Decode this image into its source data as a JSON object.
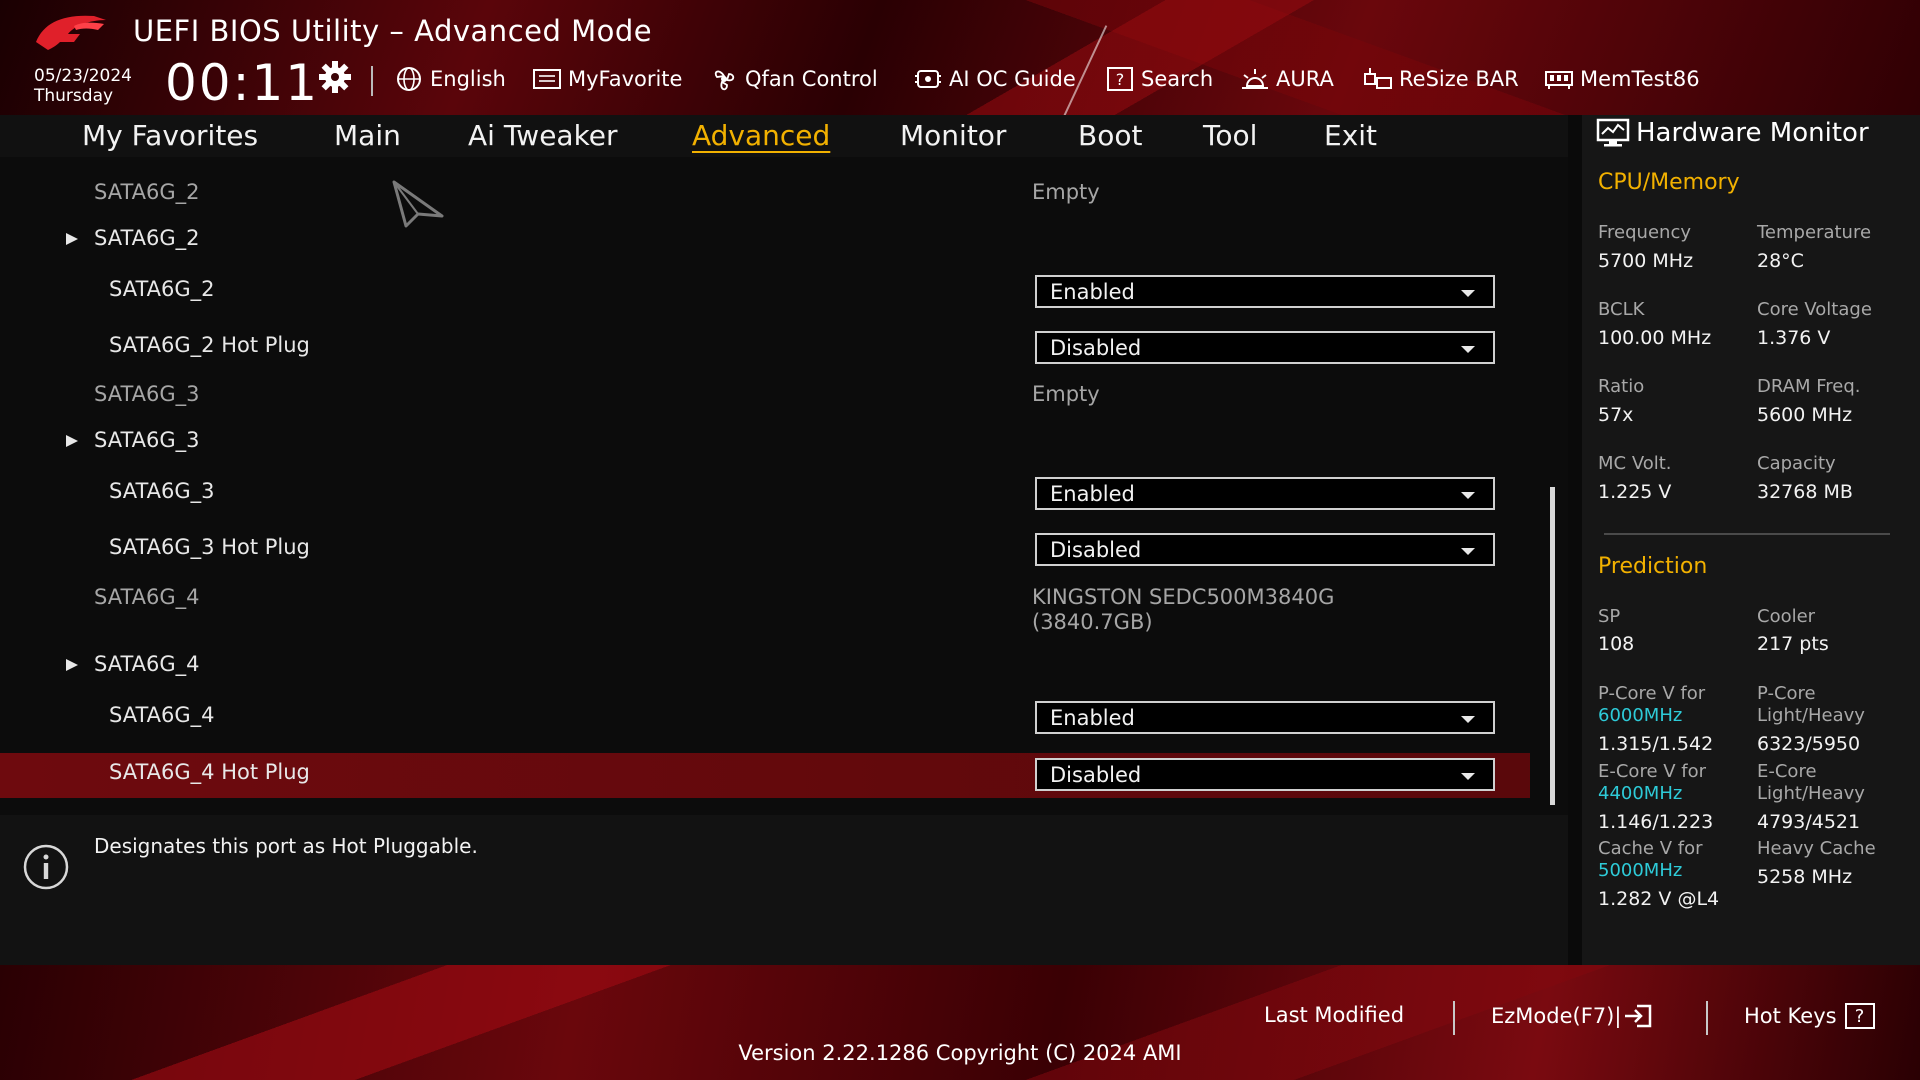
{
  "header": {
    "title": "UEFI BIOS Utility – Advanced Mode",
    "date": "05/23/2024",
    "day": "Thursday",
    "time": "00:11",
    "tools": [
      {
        "label": "English",
        "icon": "globe-icon"
      },
      {
        "label": "MyFavorite",
        "icon": "favorite-icon"
      },
      {
        "label": "Qfan Control",
        "icon": "fan-icon"
      },
      {
        "label": "AI OC Guide",
        "icon": "ai-oc-icon"
      },
      {
        "label": "Search",
        "icon": "search-icon"
      },
      {
        "label": "AURA",
        "icon": "aura-icon"
      },
      {
        "label": "ReSize BAR",
        "icon": "resize-bar-icon"
      },
      {
        "label": "MemTest86",
        "icon": "memtest-icon"
      }
    ]
  },
  "menu": {
    "tabs": [
      "My Favorites",
      "Main",
      "Ai Tweaker",
      "Advanced",
      "Monitor",
      "Boot",
      "Tool",
      "Exit"
    ],
    "active": "Advanced"
  },
  "rows": {
    "sata2_info": {
      "label": "SATA6G_2",
      "value": "Empty"
    },
    "sata2_group": {
      "label": "SATA6G_2"
    },
    "sata2_port": {
      "label": "SATA6G_2",
      "value": "Enabled"
    },
    "sata2_hotplug": {
      "label": "SATA6G_2 Hot Plug",
      "value": "Disabled"
    },
    "sata3_info": {
      "label": "SATA6G_3",
      "value": "Empty"
    },
    "sata3_group": {
      "label": "SATA6G_3"
    },
    "sata3_port": {
      "label": "SATA6G_3",
      "value": "Enabled"
    },
    "sata3_hotplug": {
      "label": "SATA6G_3 Hot Plug",
      "value": "Disabled"
    },
    "sata4_info": {
      "label": "SATA6G_4",
      "value_line1": "KINGSTON SEDC500M3840G",
      "value_line2": "(3840.7GB)"
    },
    "sata4_group": {
      "label": "SATA6G_4"
    },
    "sata4_port": {
      "label": "SATA6G_4",
      "value": "Enabled"
    },
    "sata4_hotplug": {
      "label": "SATA6G_4 Hot Plug",
      "value": "Disabled"
    }
  },
  "help": {
    "text": "Designates this port as Hot Pluggable."
  },
  "hw_monitor": {
    "title": "Hardware Monitor",
    "cpu_memory": {
      "section": "CPU/Memory",
      "frequency": {
        "label": "Frequency",
        "value": "5700 MHz"
      },
      "temperature": {
        "label": "Temperature",
        "value": "28°C"
      },
      "bclk": {
        "label": "BCLK",
        "value": "100.00 MHz"
      },
      "core_voltage": {
        "label": "Core Voltage",
        "value": "1.376 V"
      },
      "ratio": {
        "label": "Ratio",
        "value": "57x"
      },
      "dram_freq": {
        "label": "DRAM Freq.",
        "value": "5600 MHz"
      },
      "mc_volt": {
        "label": "MC Volt.",
        "value": "1.225 V"
      },
      "capacity": {
        "label": "Capacity",
        "value": "32768 MB"
      }
    },
    "prediction": {
      "section": "Prediction",
      "sp": {
        "label": "SP",
        "value": "108"
      },
      "cooler": {
        "label": "Cooler",
        "value": "217 pts"
      },
      "pcore_v": {
        "label": "P-Core V for",
        "freq": "6000MHz",
        "value": "1.315/1.542"
      },
      "pcore_lh": {
        "label_line1": "P-Core",
        "label_line2": "Light/Heavy",
        "value": "6323/5950"
      },
      "ecore_v": {
        "label": "E-Core V for",
        "freq": "4400MHz",
        "value": "1.146/1.223"
      },
      "ecore_lh": {
        "label_line1": "E-Core",
        "label_line2": "Light/Heavy",
        "value": "4793/4521"
      },
      "cache_v": {
        "label": "Cache V for",
        "freq": "5000MHz",
        "value": "1.282 V @L4"
      },
      "heavy_cache": {
        "label": "Heavy Cache",
        "value": "5258 MHz"
      }
    }
  },
  "footer": {
    "last_modified": "Last Modified",
    "ezmode": "EzMode(F7)|",
    "hot_keys": "Hot Keys",
    "hot_keys_box": "?",
    "version": "Version 2.22.1286 Copyright (C) 2024 AMI"
  },
  "colors": {
    "accent": "#f2b100",
    "selection": "#6e0a0e",
    "freq_highlight": "#2ecbd8"
  }
}
